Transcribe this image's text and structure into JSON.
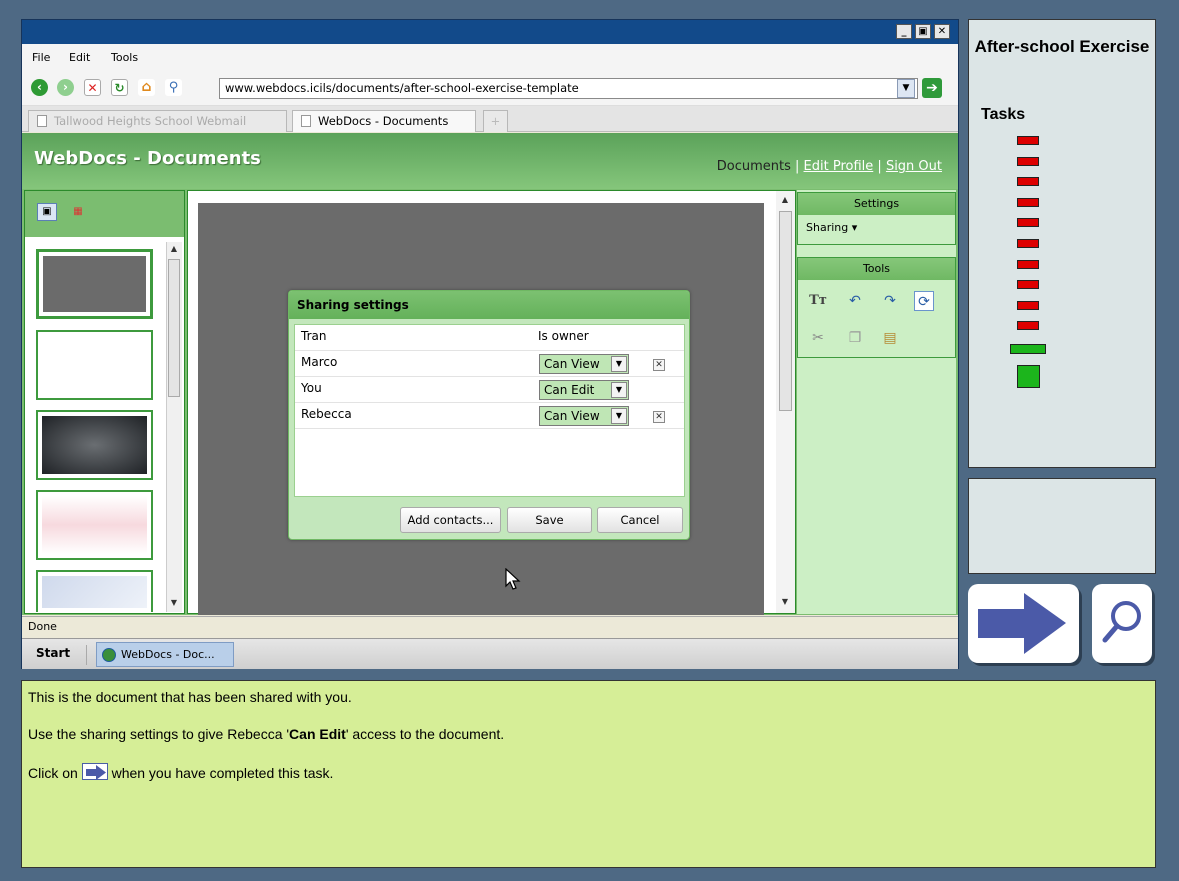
{
  "browser": {
    "window_controls": [
      "_",
      "▣",
      "✕"
    ],
    "menu": [
      "File",
      "Edit",
      "Tools"
    ],
    "address": "www.webdocs.icils/documents/after-school-exercise-template",
    "tabs": [
      {
        "label": "Tallwood Heights School Webmail",
        "active": false
      },
      {
        "label": "WebDocs - Documents",
        "active": true
      }
    ],
    "new_tab": "+",
    "status": "Done"
  },
  "app": {
    "title": "WebDocs - Documents",
    "links": {
      "documents": "Documents",
      "edit_profile": "Edit Profile",
      "sign_out": "Sign Out",
      "separator": "|"
    },
    "settings": {
      "header": "Settings",
      "sharing": "Sharing ▾"
    },
    "tools": {
      "header": "Tools",
      "text_tool": "Tт"
    }
  },
  "dialog": {
    "title": "Sharing settings",
    "rows": [
      {
        "name": "Tran",
        "permission": "Is owner",
        "editable": false
      },
      {
        "name": "Marco",
        "permission": "Can View",
        "editable": true,
        "removable": true
      },
      {
        "name": "You",
        "permission": "Can Edit",
        "editable": true,
        "removable": false
      },
      {
        "name": "Rebecca",
        "permission": "Can View",
        "editable": true,
        "removable": true
      }
    ],
    "buttons": {
      "add": "Add contacts...",
      "save": "Save",
      "cancel": "Cancel"
    }
  },
  "taskbar": {
    "start": "Start",
    "item": "WebDocs - Doc..."
  },
  "task_panel": {
    "title": "After-school Exercise",
    "tasks_label": "Tasks",
    "completed_tasks": 10,
    "colors": {
      "completed": "#dd0000",
      "current": "#1cb51c"
    }
  },
  "instructions": {
    "line1": "This is the document that has been shared with you.",
    "line2_pre": "Use the sharing settings to give Rebecca '",
    "line2_bold": "Can Edit",
    "line2_post": "' access to the document.",
    "line3_pre": "Click on",
    "line3_post": "when you have completed this task."
  }
}
